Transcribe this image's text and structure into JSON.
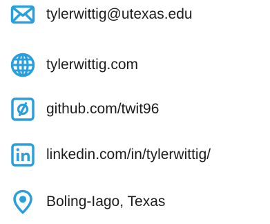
{
  "accent_color": "#2b9fdb",
  "contacts": [
    {
      "icon": "envelope-icon",
      "text": "tylerwittig@utexas.edu"
    },
    {
      "icon": "globe-icon",
      "text": "tylerwittig.com"
    },
    {
      "icon": "github-icon",
      "text": "github.com/twit96"
    },
    {
      "icon": "linkedin-icon",
      "text": "linkedin.com/in/tylerwittig/"
    },
    {
      "icon": "location-pin-icon",
      "text": "Boling-Iago, Texas"
    }
  ]
}
